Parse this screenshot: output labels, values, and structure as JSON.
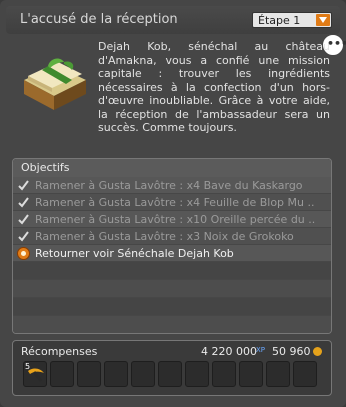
{
  "window": {
    "title": "L'accusé de la réception",
    "step_select": "Étape 1"
  },
  "description": "Dejah Kob, sénéchal au château d'Amakna, vous a confié une mission capitale : trouver les ingrédients nécessaires à la confection d'un hors-d'œuvre inoubliable. Grâce à votre aide, la réception de l'ambassadeur sera un succès. Comme toujours.",
  "objectives": {
    "header": "Objectifs",
    "items": [
      {
        "text": "Ramener à Gusta Lavôtre : x4 Bave du Kaskargo",
        "status": "done"
      },
      {
        "text": "Ramener à Gusta Lavôtre : x4 Feuille de Blop Mu ...",
        "status": "done"
      },
      {
        "text": "Ramener à Gusta Lavôtre : x10 Oreille percée du ...",
        "status": "done"
      },
      {
        "text": "Ramener à Gusta Lavôtre : x3 Noix de Grokoko",
        "status": "done"
      },
      {
        "text": "Retourner voir Sénéchale Dejah Kob",
        "status": "active"
      }
    ]
  },
  "rewards": {
    "label": "Récompenses",
    "xp": "4 220 000",
    "kamas": "50 960",
    "first_item_qty": "5"
  },
  "colors": {
    "accent": "#e07b16",
    "xp": "#6aa8ff",
    "kamas": "#e5a21b"
  },
  "icons": {
    "check": "check-icon",
    "target": "target-icon",
    "dropdown": "dropdown-arrow-icon",
    "more": "chat-more-icon"
  }
}
